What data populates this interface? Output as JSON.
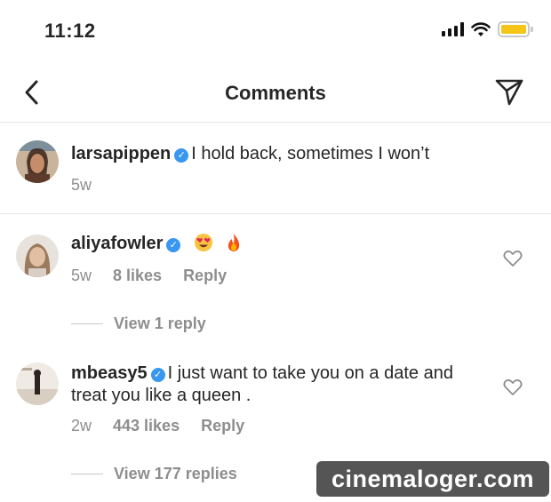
{
  "status_bar": {
    "time": "11:12"
  },
  "nav": {
    "title": "Comments"
  },
  "caption": {
    "username": "larsapippen",
    "text": "I hold back, sometimes I won’t",
    "age": "5w"
  },
  "comments": [
    {
      "username": "aliyafowler",
      "text_emojis": [
        "heart-eyes-emoji",
        "fire-emoji"
      ],
      "age": "5w",
      "likes": "8 likes",
      "reply": "Reply",
      "view_replies": "View 1 reply"
    },
    {
      "username": "mbeasy5",
      "text": "I just want to take you on a date and treat you like a queen .",
      "age": "2w",
      "likes": "443 likes",
      "reply": "Reply",
      "view_replies": "View 177 replies"
    }
  ],
  "watermark": "cinemaloger.com",
  "colors": {
    "verified": "#3897f0",
    "battery": "#f5c518",
    "muted_text": "#8e8e8e",
    "text": "#262626"
  },
  "icons": [
    "back-icon",
    "send-icon",
    "heart-icon",
    "verified-icon",
    "signal-icon",
    "wifi-icon",
    "battery-icon"
  ]
}
